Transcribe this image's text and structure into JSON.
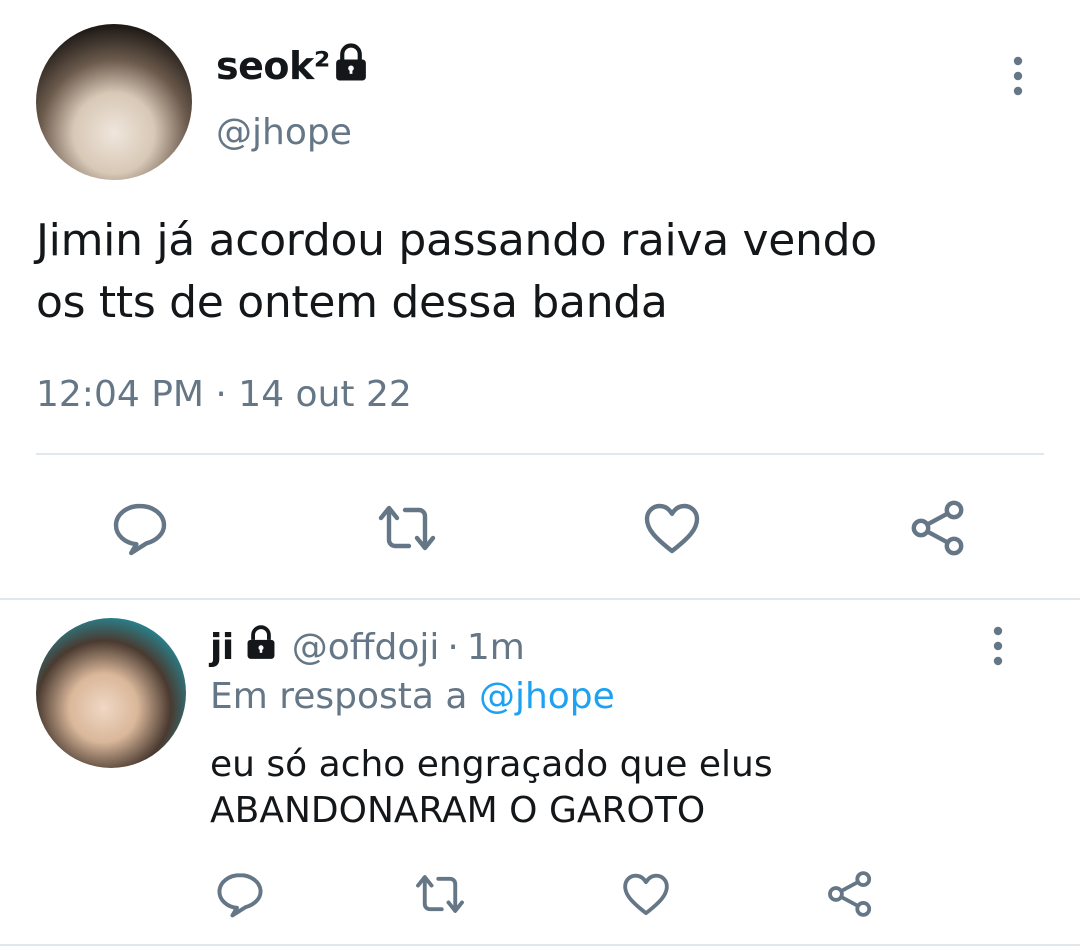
{
  "main_tweet": {
    "display_name": "seok²",
    "handle": "@jhope",
    "text_line1": "Jimin já acordou passando raiva vendo",
    "text_line2": "os tts de ontem dessa banda",
    "timestamp": "12:04 PM · 14 out 22",
    "protected_icon": "lock-icon",
    "actions": [
      "reply-icon",
      "retweet-icon",
      "like-icon",
      "share-icon"
    ]
  },
  "reply_tweet": {
    "display_name": "ji",
    "handle": "@offdoji",
    "separator": "·",
    "time": "1m",
    "replying_prefix": "Em resposta a ",
    "replying_to": "@jhope",
    "text_line1": "eu só acho engraçado que elus",
    "text_line2": "ABANDONARAM O GAROTO",
    "protected_icon": "lock-icon",
    "actions": [
      "reply-icon",
      "retweet-icon",
      "like-icon",
      "share-icon"
    ]
  },
  "colors": {
    "text_primary": "#14171a",
    "text_secondary": "#657786",
    "accent": "#1da1f2",
    "icon": "#657786",
    "divider": "#e1e8ed"
  }
}
